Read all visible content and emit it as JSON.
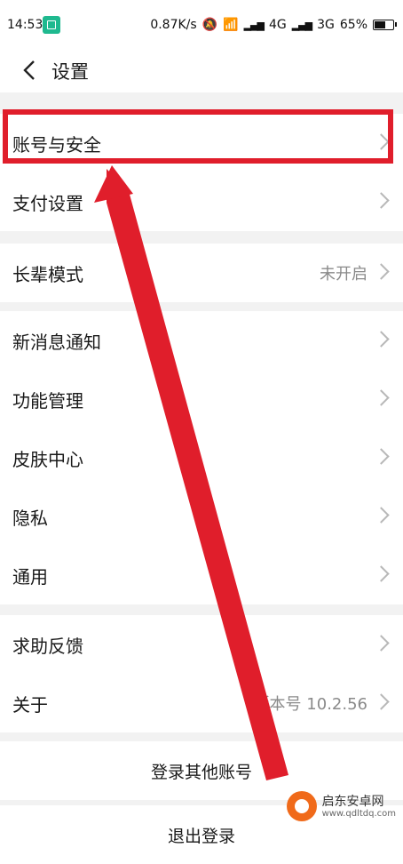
{
  "status_bar": {
    "time": "14:53",
    "speed": "0.87K/s",
    "network1": "4G",
    "network2": "3G",
    "battery": "65%",
    "battery_level": 0.65
  },
  "header": {
    "title": "设置"
  },
  "groups": [
    {
      "items": [
        {
          "label": "账号与安全"
        },
        {
          "label": "支付设置"
        }
      ]
    },
    {
      "items": [
        {
          "label": "长辈模式",
          "value": "未开启"
        }
      ]
    },
    {
      "items": [
        {
          "label": "新消息通知"
        },
        {
          "label": "功能管理"
        },
        {
          "label": "皮肤中心"
        },
        {
          "label": "隐私"
        },
        {
          "label": "通用"
        }
      ]
    },
    {
      "items": [
        {
          "label": "求助反馈"
        },
        {
          "label": "关于",
          "value": "版本号 10.2.56"
        }
      ]
    }
  ],
  "actions": {
    "login_other": "登录其他账号",
    "logout": "退出登录"
  },
  "watermark": {
    "name": "启东安卓网",
    "url": "www.qdltdq.com"
  },
  "colors": {
    "annotation": "#e01e2b",
    "background": "#f2f2f2"
  }
}
